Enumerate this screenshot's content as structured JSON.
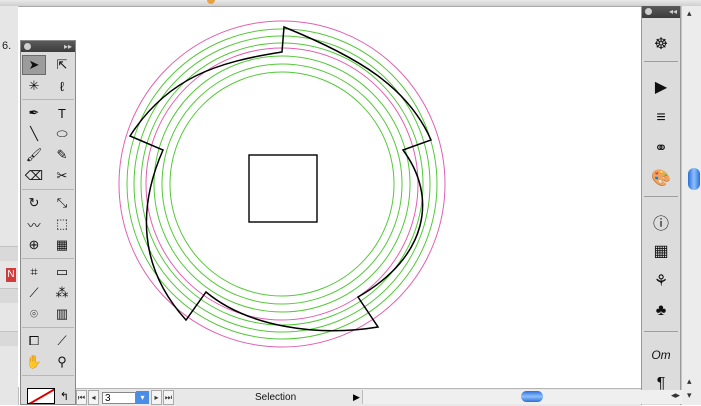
{
  "window": {
    "title": ""
  },
  "left_window": {
    "number_fragment": "6.",
    "red_fragment": "N"
  },
  "tools": [
    [
      {
        "name": "selection-tool-icon",
        "glyph": "➤",
        "selected": true
      },
      {
        "name": "direct-selection-tool-icon",
        "glyph": "⇱"
      }
    ],
    [
      {
        "name": "magic-wand-tool-icon",
        "glyph": "✳"
      },
      {
        "name": "lasso-tool-icon",
        "glyph": "ℓ"
      }
    ],
    [
      {
        "name": "pen-tool-icon",
        "glyph": "✒"
      },
      {
        "name": "type-tool-icon",
        "glyph": "T"
      }
    ],
    [
      {
        "name": "line-tool-icon",
        "glyph": "╲"
      },
      {
        "name": "ellipse-tool-icon",
        "glyph": "⬭"
      }
    ],
    [
      {
        "name": "paintbrush-tool-icon",
        "glyph": "🖌"
      },
      {
        "name": "pencil-tool-icon",
        "glyph": "✎"
      }
    ],
    [
      {
        "name": "eraser-tool-icon",
        "glyph": "⌫"
      },
      {
        "name": "scissors-tool-icon",
        "glyph": "✂"
      }
    ],
    [
      {
        "name": "rotate-tool-icon",
        "glyph": "↻"
      },
      {
        "name": "scale-tool-icon",
        "glyph": "⤡"
      }
    ],
    [
      {
        "name": "warp-tool-icon",
        "glyph": "〰"
      },
      {
        "name": "free-transform-tool-icon",
        "glyph": "⬚"
      }
    ],
    [
      {
        "name": "shape-builder-tool-icon",
        "glyph": "⊕"
      },
      {
        "name": "live-paint-tool-icon",
        "glyph": "▦"
      }
    ],
    [
      {
        "name": "mesh-tool-icon",
        "glyph": "⌗"
      },
      {
        "name": "gradient-tool-icon",
        "glyph": "▭"
      }
    ],
    [
      {
        "name": "eyedropper-tool-icon",
        "glyph": "⟋"
      },
      {
        "name": "blend-tool-icon",
        "glyph": "⁂"
      }
    ],
    [
      {
        "name": "symbol-sprayer-tool-icon",
        "glyph": "⌾"
      },
      {
        "name": "column-graph-tool-icon",
        "glyph": "▥"
      }
    ],
    [
      {
        "name": "artboard-tool-icon",
        "glyph": "⧠"
      },
      {
        "name": "slice-tool-icon",
        "glyph": "⟋"
      }
    ],
    [
      {
        "name": "hand-tool-icon",
        "glyph": "✋"
      },
      {
        "name": "zoom-tool-icon",
        "glyph": "⚲"
      }
    ]
  ],
  "dock": [
    {
      "name": "navigator-icon",
      "glyph": "☸"
    },
    {
      "name": "actions-icon",
      "glyph": "▶"
    },
    {
      "name": "layers-icon",
      "glyph": "≡"
    },
    {
      "name": "links-icon",
      "glyph": "⚭"
    },
    {
      "name": "color-palette-icon",
      "glyph": "🎨"
    },
    {
      "name": "info-icon",
      "glyph": "ⓘ"
    },
    {
      "name": "swatches-icon",
      "glyph": "▦"
    },
    {
      "name": "brushes-icon",
      "glyph": "⚘"
    },
    {
      "name": "symbols-icon",
      "glyph": "♣"
    },
    {
      "name": "opentype-icon",
      "glyph": "Oт"
    },
    {
      "name": "paragraph-icon",
      "glyph": "¶"
    }
  ],
  "status": {
    "page_number": "3",
    "mode_label": "Selection"
  },
  "colors": {
    "guide_pink": "#e060b0",
    "guide_green": "#55c83a",
    "shape_stroke": "#000000"
  }
}
